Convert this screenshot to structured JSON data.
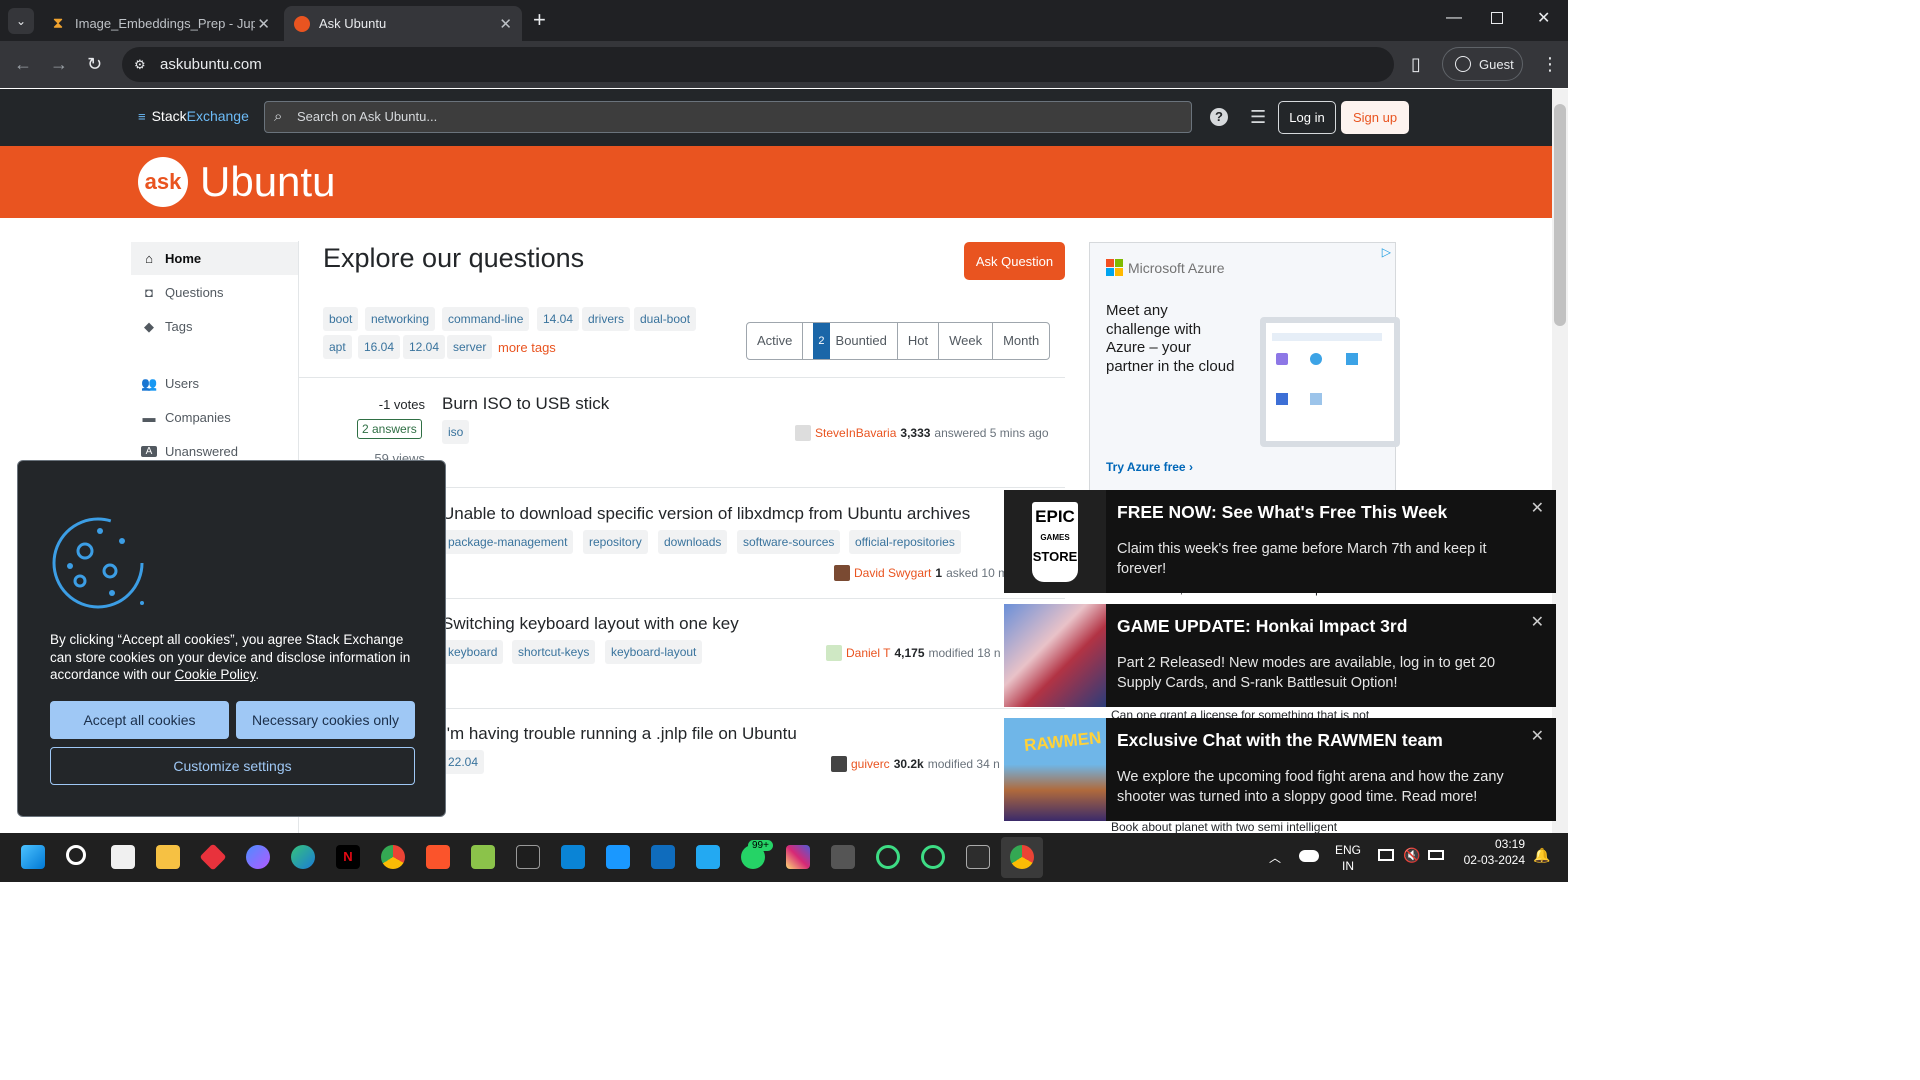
{
  "browser": {
    "tabs": [
      {
        "title": "Image_Embeddings_Prep - Jupy",
        "active": false
      },
      {
        "title": "Ask Ubuntu",
        "active": true
      }
    ],
    "new_tab": "+",
    "url": "askubuntu.com",
    "profile": "Guest"
  },
  "topbar": {
    "brand_stack": "Stack",
    "brand_exchange": "Exchange",
    "search_placeholder": "Search on Ask Ubuntu...",
    "login": "Log in",
    "signup": "Sign up"
  },
  "banner": {
    "logo_mark": "ask",
    "logo_word": "Ubuntu"
  },
  "sidebar": {
    "items": [
      {
        "label": "Home",
        "icon": "home-icon",
        "active": true
      },
      {
        "label": "Questions",
        "icon": "questions-icon",
        "active": false
      },
      {
        "label": "Tags",
        "icon": "tag-icon",
        "active": false
      },
      {
        "label": "Users",
        "icon": "users-icon",
        "active": false
      },
      {
        "label": "Companies",
        "icon": "companies-icon",
        "active": false
      },
      {
        "label": "Unanswered",
        "icon": "unanswered-icon",
        "active": false
      }
    ]
  },
  "main": {
    "title": "Explore our questions",
    "ask_button": "Ask Question",
    "tags": [
      "boot",
      "networking",
      "command-line",
      "14.04",
      "drivers",
      "dual-boot",
      "apt",
      "16.04",
      "12.04",
      "server"
    ],
    "more_tags": "more tags",
    "filters": {
      "active": "Active",
      "bountied_count": "2",
      "bountied": "Bountied",
      "hot": "Hot",
      "week": "Week",
      "month": "Month"
    },
    "questions": [
      {
        "votes": "-1 votes",
        "answers": "2 answers",
        "views": "59 views",
        "title": "Burn ISO to USB stick",
        "tags": [
          "iso"
        ],
        "user": "SteveInBavaria",
        "rep": "3,333",
        "action": "answered 5 mins ago"
      },
      {
        "title": "Unable to download specific version of libxdmcp from Ubuntu archives",
        "tags": [
          "package-management",
          "repository",
          "downloads",
          "software-sources",
          "official-repositories"
        ],
        "user": "David Swygart",
        "rep": "1",
        "action": "asked 10 m"
      },
      {
        "title": "Switching keyboard layout with one key",
        "tags": [
          "keyboard",
          "shortcut-keys",
          "keyboard-layout"
        ],
        "user": "Daniel T",
        "rep": "4,175",
        "action": "modified 18 n"
      },
      {
        "title": "I'm having trouble running a .jnlp file on Ubuntu",
        "tags": [
          "22.04"
        ],
        "user": "guiverc",
        "rep": "30.2k",
        "action": "modified 34 n"
      }
    ]
  },
  "ad": {
    "brand": "Microsoft Azure",
    "headline": "Meet any challenge with Azure – your partner in the cloud",
    "cta": "Try Azure free",
    "cta_arrow": "›"
  },
  "cookie": {
    "text_before": "By clicking “Accept all cookies”, you agree Stack Exchange can store cookies on your device and disclose information in accordance with our ",
    "policy_link": "Cookie Policy",
    "text_after": ".",
    "accept": "Accept all cookies",
    "necessary": "Necessary cookies only",
    "customize": "Customize settings"
  },
  "peek_text": {
    "line1": "the electrons, how resistances warm up?",
    "line2": "Can one grant a license for something that is not",
    "line3": "Book about planet with two semi intelligent"
  },
  "toasts": [
    {
      "title": "FREE NOW: See What's Free This Week",
      "body": "Claim this week's free game before March 7th and keep it forever!",
      "image": "epic-games-store-logo",
      "logo_top": "EPIC",
      "logo_mid": "GAMES",
      "logo_bottom": "STORE"
    },
    {
      "title": "GAME UPDATE: Honkai Impact 3rd",
      "body": "Part 2 Released! New modes are available, log in to get 20 Supply Cards, and S-rank Battlesuit Option!",
      "image": "honkai-artwork"
    },
    {
      "title": "Exclusive Chat with the RAWMEN team",
      "body": "We explore the upcoming food fight arena and how the zany shooter was turned into a sloppy good time. Read more!",
      "image": "rawmen-artwork",
      "logo": "RAWMEN"
    }
  ],
  "taskbar": {
    "whatsapp_badge": "99+",
    "lang_top": "ENG",
    "lang_bottom": "IN",
    "time": "03:19",
    "date": "02-03-2024"
  },
  "colors": {
    "brand": "#e95420",
    "link": "#39739d"
  }
}
